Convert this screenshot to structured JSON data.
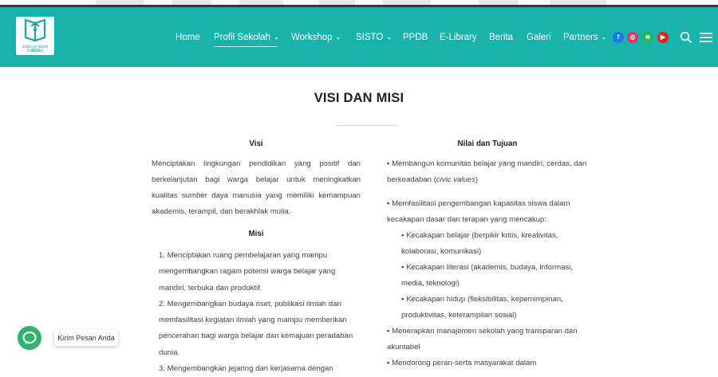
{
  "nav": {
    "items": [
      {
        "label": "Home",
        "dropdown": false
      },
      {
        "label": "Profil Sekolah",
        "dropdown": true,
        "active": true
      },
      {
        "label": "Workshop",
        "dropdown": true
      },
      {
        "label": "SISTO",
        "dropdown": true
      },
      {
        "label": "PPDB",
        "dropdown": false
      },
      {
        "label": "E-Library",
        "dropdown": false
      },
      {
        "label": "Berita",
        "dropdown": false
      },
      {
        "label": "Galeri",
        "dropdown": false
      },
      {
        "label": "Partners",
        "dropdown": true
      }
    ],
    "caret": "⌄",
    "social": [
      {
        "name": "facebook-icon",
        "glyph": "f",
        "color": "#1877f2"
      },
      {
        "name": "instagram-icon",
        "glyph": "◎",
        "color": "#e1306c"
      },
      {
        "name": "spotify-icon",
        "glyph": "≋",
        "color": "#1db954"
      },
      {
        "name": "youtube-icon",
        "glyph": "▶",
        "color": "#e62117"
      }
    ]
  },
  "logo": {
    "text": "SEKOLAH INSAN GEMILANG",
    "sub": "SIGI"
  },
  "page": {
    "title": "VISI DAN MISI"
  },
  "visi": {
    "heading": "Visi",
    "text": "Menciptakan lingkungan pendidikan yang positif dan berkelanjutan bagi warga belajar untuk meningkatkan kualitas sumber daya manusia yang memiliki kemampuan akademis, terampil, dan berakhlak mulia."
  },
  "misi": {
    "heading": "Misi",
    "items": [
      "1. Menciptakan ruang pembelajaran yang mampu mengembangkan ragam potensi warga belajar yang mandiri, terbuka dan produktif.",
      "2. Mengembangkan budaya riset, publikasi ilmiah dan memfasilitasi kegiatan ilmiah yang mampu memberikan pencerahan bagi warga belajar dan kemajuan peradaban dunia.",
      "3. Mengembangkan jejaring dan kerjasama dengan"
    ]
  },
  "nilai": {
    "heading": "Nilai dan Tujuan",
    "item1": "▪ Membangun komunitas belajar yang mandiri, cerdas, dan berkeadaban (",
    "item1_em": "civic values",
    "item1_end": ")",
    "item2": "▪ Memfasilitasi pengembangan kapasitas siswa dalam kecakapan dasar dan terapan yang mencakup:",
    "sub": [
      "▪ Kecakapan belajar (berpikir kritis, kreativitas, kolaborasi, komunikasi)",
      "▪ Kecakapan literasi (akademis, budaya, informasi, media, teknologi)",
      "▪ Kecakapan hidup (fleksibilitas, kepemimpinan, produktivitas, keterampilan sosial)"
    ],
    "item3": "▪ Menerapkan manajemen sekolah yang transparan dan akuntabel",
    "item4": "▪ Mendorong peran-serta masyarakat dalam"
  },
  "chat": {
    "label": "Kirim Pesan Anda"
  }
}
